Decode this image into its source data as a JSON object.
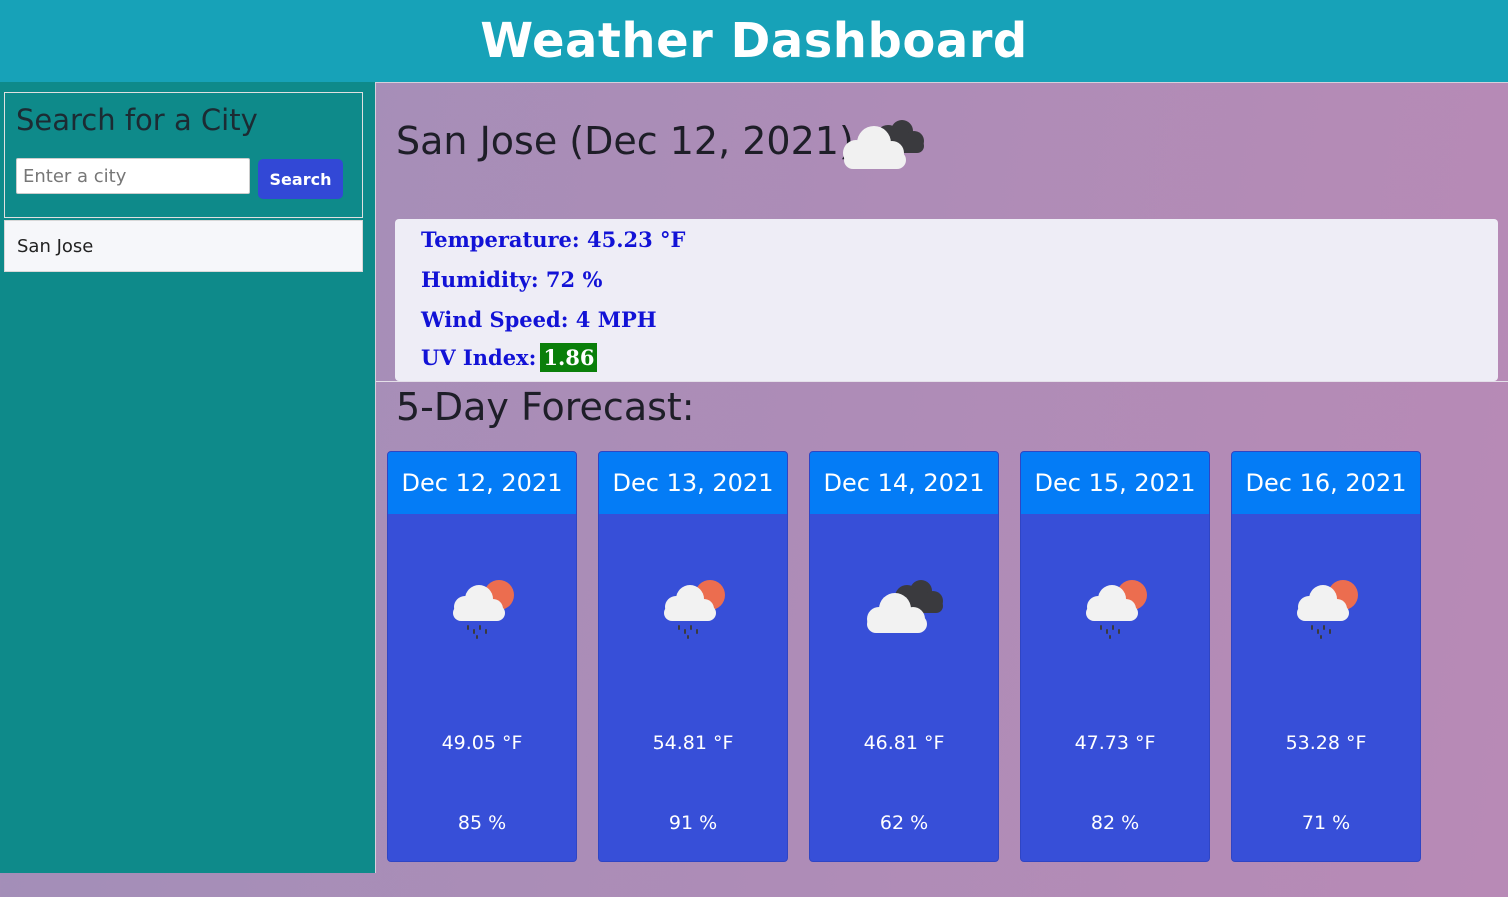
{
  "header": {
    "title": "Weather Dashboard"
  },
  "sidebar": {
    "search_title": "Search for a City",
    "input_placeholder": "Enter a city",
    "input_value": "",
    "search_label": "Search",
    "history": [
      "San Jose"
    ]
  },
  "current": {
    "title": "San Jose (Dec 12, 2021)",
    "icon": "clouds-icon",
    "temperature": "Temperature: 45.23 °F",
    "humidity": "Humidity: 72 %",
    "wind": "Wind Speed: 4 MPH",
    "uv_label": "UV Index:",
    "uv_value": "1.86",
    "uv_color": "#0a7f0a"
  },
  "forecast": {
    "title": "5-Day Forecast:",
    "days": [
      {
        "date": "Dec 12, 2021",
        "icon": "rain-sun-icon",
        "temp": "49.05 °F",
        "humidity": "85 %"
      },
      {
        "date": "Dec 13, 2021",
        "icon": "rain-sun-icon",
        "temp": "54.81 °F",
        "humidity": "91 %"
      },
      {
        "date": "Dec 14, 2021",
        "icon": "clouds-icon",
        "temp": "46.81 °F",
        "humidity": "62 %"
      },
      {
        "date": "Dec 15, 2021",
        "icon": "rain-sun-icon",
        "temp": "47.73 °F",
        "humidity": "82 %"
      },
      {
        "date": "Dec 16, 2021",
        "icon": "rain-sun-icon",
        "temp": "53.28 °F",
        "humidity": "71 %"
      }
    ]
  },
  "colors": {
    "header": "#17a2b8",
    "sidebar": "#0e8a8a",
    "search_button": "#3248d6",
    "card_header": "#047cf6",
    "card_body": "#374fd8",
    "stat_text": "#1212d6"
  }
}
